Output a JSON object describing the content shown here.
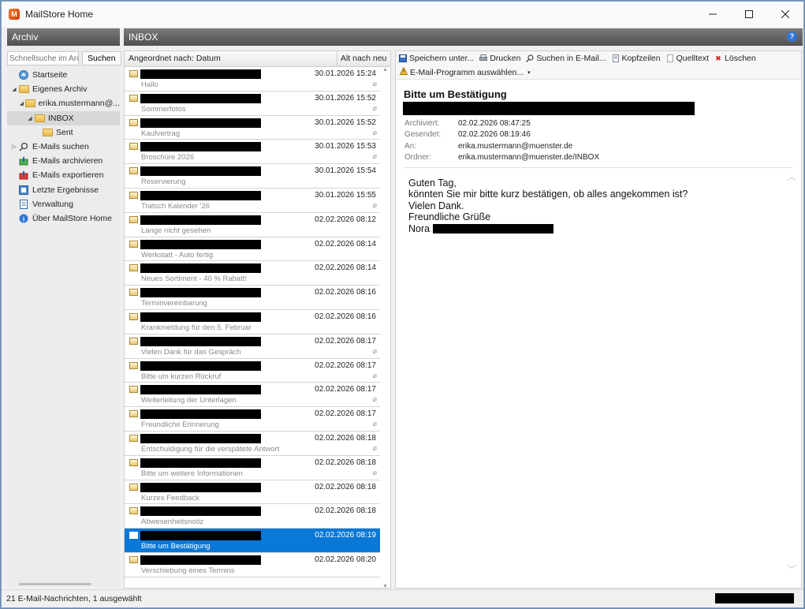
{
  "window": {
    "title": "MailStore Home",
    "controls": {
      "minimize": "—",
      "maximize": "☐",
      "close": "✕"
    }
  },
  "left": {
    "header": "Archiv",
    "search_placeholder": "Schnellsuche im Archiv",
    "search_button": "Suchen",
    "tree": [
      {
        "label": "Startseite",
        "icon": "home-icon",
        "indent": 0,
        "twisty": ""
      },
      {
        "label": "Eigenes Archiv",
        "icon": "folder-icon",
        "indent": 0,
        "twisty": "◢"
      },
      {
        "label": "erika.mustermann@...",
        "icon": "folder-icon",
        "indent": 1,
        "twisty": "◢"
      },
      {
        "label": "INBOX",
        "icon": "folder-icon",
        "indent": 2,
        "twisty": "◢",
        "selected": true
      },
      {
        "label": "Sent",
        "icon": "folder-icon",
        "indent": 3,
        "twisty": ""
      },
      {
        "label": "E-Mails suchen",
        "icon": "search-icon",
        "indent": 0,
        "twisty": "▷"
      },
      {
        "label": "E-Mails archivieren",
        "icon": "archive-icon",
        "indent": 0,
        "twisty": ""
      },
      {
        "label": "E-Mails exportieren",
        "icon": "export-icon",
        "indent": 0,
        "twisty": ""
      },
      {
        "label": "Letzte Ergebnisse",
        "icon": "results-icon",
        "indent": 0,
        "twisty": ""
      },
      {
        "label": "Verwaltung",
        "icon": "admin-icon",
        "indent": 0,
        "twisty": ""
      },
      {
        "label": "Über MailStore Home",
        "icon": "info-icon",
        "indent": 0,
        "twisty": ""
      }
    ]
  },
  "middle": {
    "header": "INBOX",
    "sort_label": "Angeordnet nach: Datum",
    "sort_order": "Alt nach neu",
    "messages": [
      {
        "date": "30.01.2026 15:24",
        "subject": "Hallo",
        "attachment": true
      },
      {
        "date": "30.01.2026 15:52",
        "subject": "Sommerfotos",
        "attachment": true
      },
      {
        "date": "30.01.2026 15:52",
        "subject": "Kaufvertrag",
        "attachment": true
      },
      {
        "date": "30.01.2026 15:53",
        "subject": "Broschüre 2026",
        "attachment": true
      },
      {
        "date": "30.01.2026 15:54",
        "subject": "Reservierung",
        "attachment": false
      },
      {
        "date": "30.01.2026 15:55",
        "subject": "Tratsch Kalender '26",
        "attachment": true
      },
      {
        "date": "02.02.2026 08:12",
        "subject": "Lange nicht gesehen",
        "attachment": false
      },
      {
        "date": "02.02.2026 08:14",
        "subject": "Werkstatt - Auto fertig",
        "attachment": false
      },
      {
        "date": "02.02.2026 08:14",
        "subject": "Neues Sortiment - 40 % Rabatt!",
        "attachment": false
      },
      {
        "date": "02.02.2026 08:16",
        "subject": "Terminvereinbarung",
        "attachment": false
      },
      {
        "date": "02.02.2026 08:16",
        "subject": "Krankmeldung für den 5. Februar",
        "attachment": false
      },
      {
        "date": "02.02.2026 08:17",
        "subject": "Vielen Dank für das Gespräch",
        "attachment": true
      },
      {
        "date": "02.02.2026 08:17",
        "subject": "Bitte um kurzen Rückruf",
        "attachment": true
      },
      {
        "date": "02.02.2026 08:17",
        "subject": "Weiterleitung der Unterlagen",
        "attachment": true
      },
      {
        "date": "02.02.2026 08:17",
        "subject": "Freundliche Erinnerung",
        "attachment": true
      },
      {
        "date": "02.02.2026 08:18",
        "subject": "Entschuldigung für die verspätete Antwort",
        "attachment": true
      },
      {
        "date": "02.02.2026 08:18",
        "subject": "Bitte um weitere Informationen",
        "attachment": true
      },
      {
        "date": "02.02.2026 08:18",
        "subject": "Kurzes Feedback",
        "attachment": false
      },
      {
        "date": "02.02.2026 08:18",
        "subject": "Abwesenheitsnotiz",
        "attachment": false
      },
      {
        "date": "02.02.2026 08:19",
        "subject": "Bitte um Bestätigung",
        "attachment": false,
        "selected": true
      },
      {
        "date": "02.02.2026 08:20",
        "subject": "Verschiebung eines Termins",
        "attachment": false
      }
    ]
  },
  "reader": {
    "toolbar": [
      "Speichern unter...",
      "Drucken",
      "Suchen in E-Mail...",
      "Kopfzeilen",
      "Quelltext",
      "Löschen"
    ],
    "email_program": "E-Mail-Programm auswählen...",
    "subject": "Bitte um Bestätigung",
    "meta": [
      {
        "label": "Archiviert:",
        "value": "02.02.2026 08:47:25"
      },
      {
        "label": "Gesendet:",
        "value": "02.02.2026 08:19:46"
      },
      {
        "label": "An:",
        "value": "erika.mustermann@muenster.de"
      },
      {
        "label": "Ordner:",
        "value": "erika.mustermann@muenster.de/INBOX"
      }
    ],
    "body": [
      "Guten Tag,",
      "könnten Sie mir bitte kurz bestätigen, ob alles angekommen ist?",
      "Vielen Dank.",
      "Freundliche Grüße",
      "Nora"
    ]
  },
  "status": {
    "text": "21 E-Mail-Nachrichten, 1 ausgewählt"
  },
  "colors": {
    "selection": "#0a78d7",
    "header_bar": "#5f5f5f",
    "delete_red": "#d9231b",
    "help_blue": "#2f76d8"
  }
}
